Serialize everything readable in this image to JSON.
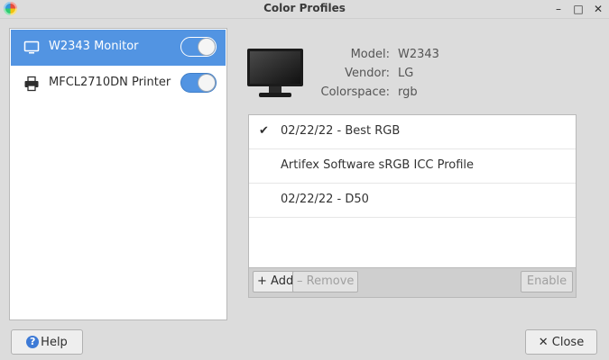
{
  "window": {
    "title": "Color Profiles",
    "minimize": "–",
    "maximize": "□",
    "close": "✕"
  },
  "devices": [
    {
      "label": "W2343 Monitor",
      "icon": "monitor-icon",
      "enabled": true,
      "selected": true
    },
    {
      "label": "MFCL2710DN Printer",
      "icon": "printer-icon",
      "enabled": true,
      "selected": false
    }
  ],
  "info": {
    "model_label": "Model:",
    "model_value": "W2343",
    "vendor_label": "Vendor:",
    "vendor_value": "LG",
    "colorspace_label": "Colorspace:",
    "colorspace_value": "rgb"
  },
  "profiles": [
    {
      "name": "02/22/22 - Best RGB",
      "active": true
    },
    {
      "name": "Artifex Software sRGB ICC Profile",
      "active": false
    },
    {
      "name": "02/22/22 - D50",
      "active": false
    }
  ],
  "toolbar": {
    "add": "+ Add",
    "remove": "– Remove",
    "enable": "Enable"
  },
  "footer": {
    "help": "Help",
    "close": "✕ Close"
  },
  "colors": {
    "accent": "#5294e2"
  }
}
